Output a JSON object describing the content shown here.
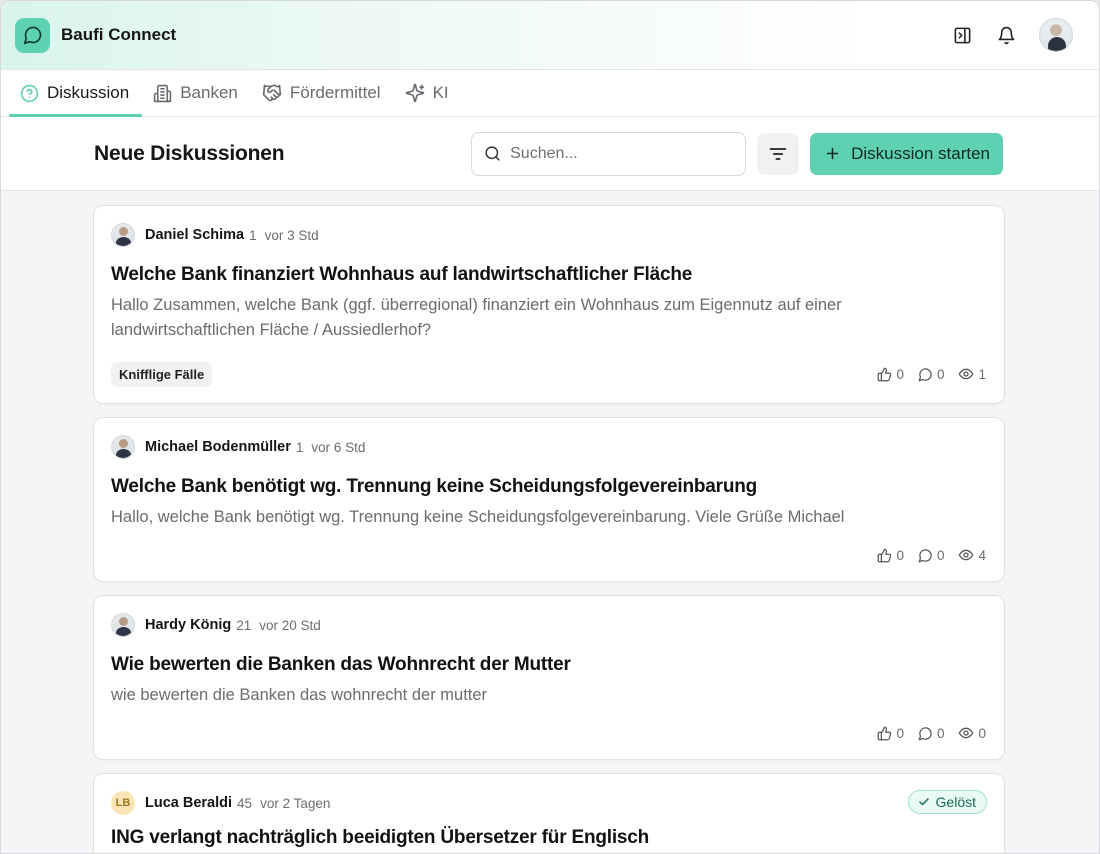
{
  "app": {
    "name": "Baufi Connect"
  },
  "tabs": [
    {
      "label": "Diskussion",
      "icon": "help-circle-icon",
      "active": true
    },
    {
      "label": "Banken",
      "icon": "building-icon",
      "active": false
    },
    {
      "label": "Fördermittel",
      "icon": "handshake-icon",
      "active": false
    },
    {
      "label": "KI",
      "icon": "sparkles-icon",
      "active": false
    }
  ],
  "toolbar": {
    "title": "Neue Diskussionen",
    "search_placeholder": "Suchen...",
    "primary_button": "Diskussion starten"
  },
  "colors": {
    "accent": "#5fd1b3"
  },
  "posts": [
    {
      "author": "Daniel Schima",
      "points": "1",
      "time": "vor 3 Std",
      "title": "Welche Bank finanziert Wohnhaus auf landwirtschaftlicher Fläche",
      "body": "Hallo Zusammen, welche Bank (ggf. überregional) finanziert ein Wohnhaus zum Eigennutz auf einer landwirtschaftlichen Fläche / Aussiedlerhof?",
      "tag": "Knifflige Fälle",
      "likes": "0",
      "comments": "0",
      "views": "1"
    },
    {
      "author": "Michael Bodenmüller",
      "points": "1",
      "time": "vor 6 Std",
      "title": "Welche Bank benötigt wg. Trennung keine Scheidungsfolgevereinbarung",
      "body": "Hallo, welche Bank benötigt wg. Trennung keine Scheidungsfolgevereinbarung. Viele Grüße Michael",
      "likes": "0",
      "comments": "0",
      "views": "4"
    },
    {
      "author": "Hardy König",
      "points": "21",
      "time": "vor 20 Std",
      "title": "Wie bewerten die Banken das Wohnrecht der Mutter",
      "body": "wie bewerten die Banken das wohnrecht der mutter",
      "likes": "0",
      "comments": "0",
      "views": "0"
    },
    {
      "author": "Luca Beraldi",
      "initials": "LB",
      "points": "45",
      "time": "vor 2 Tagen",
      "title": "ING verlangt nachträglich beeidigten Übersetzer für Englisch",
      "badge": "Gelöst"
    }
  ]
}
